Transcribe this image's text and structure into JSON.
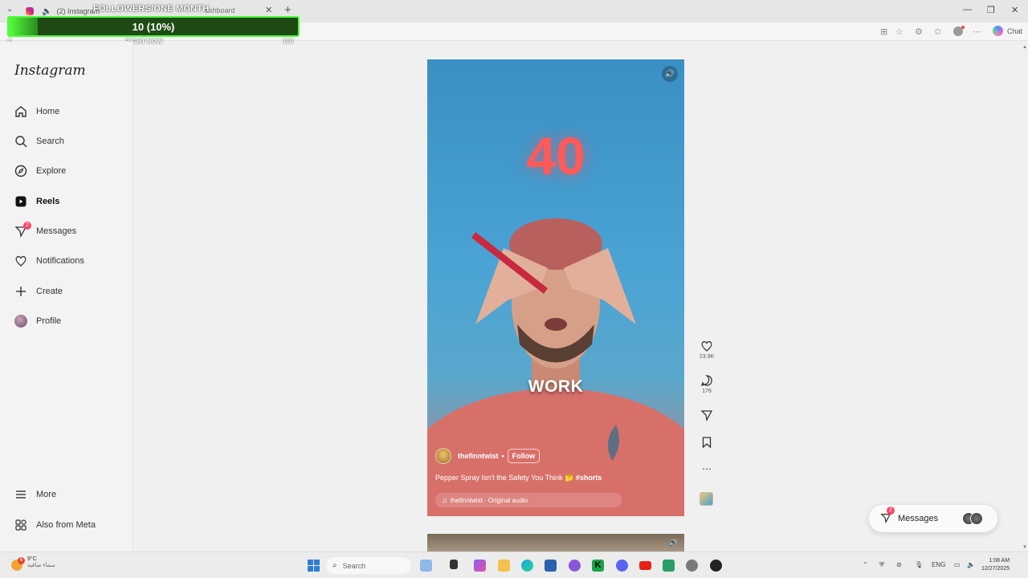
{
  "browser": {
    "tab_title": "(2) Instagram",
    "tab_title_2": "ashboard",
    "new_tab": "+",
    "tab_close": "✕",
    "chat_label": "Chat",
    "controls": [
      "—",
      "❐",
      "✕"
    ]
  },
  "overlay": {
    "title": "FOLLOWERS/ONE MONTH",
    "value": "10 (10%)",
    "progress": 0.1,
    "min_label": "0",
    "mid_label": "RIGHT NOW",
    "max_label": "100",
    "accent": "#4cff3a"
  },
  "sidebar": {
    "logo": "Instagram",
    "items": [
      {
        "label": "Home",
        "icon": "home-icon"
      },
      {
        "label": "Search",
        "icon": "search-icon"
      },
      {
        "label": "Explore",
        "icon": "compass-icon"
      },
      {
        "label": "Reels",
        "icon": "reels-icon",
        "active": true
      },
      {
        "label": "Messages",
        "icon": "messenger-icon",
        "badge": "2"
      },
      {
        "label": "Notifications",
        "icon": "heart-icon"
      },
      {
        "label": "Create",
        "icon": "plus-icon"
      },
      {
        "label": "Profile",
        "icon": "avatar"
      }
    ],
    "bottom": [
      {
        "label": "More",
        "icon": "menu-icon"
      },
      {
        "label": "Also from Meta",
        "icon": "meta-apps-icon"
      }
    ]
  },
  "reel": {
    "overlay_number": "40",
    "overlay_word": "WORK",
    "username": "thefinntwist",
    "separator": "•",
    "follow_label": "Follow",
    "description": "Pepper Spray Isn't the Safety You Think 🤔",
    "hashtag": "#shorts",
    "audio": "thefinntwist · Original audio"
  },
  "actions": {
    "likes": "23.9K",
    "comments": "176"
  },
  "messages_pill": {
    "label": "Messages",
    "badge": "2"
  },
  "taskbar": {
    "temperature": "9°C",
    "weather_text": "سماء صافية",
    "weather_badge": "6",
    "search_placeholder": "Search",
    "lang": "ENG",
    "time": "1:08 AM",
    "date": "12/27/2025"
  }
}
